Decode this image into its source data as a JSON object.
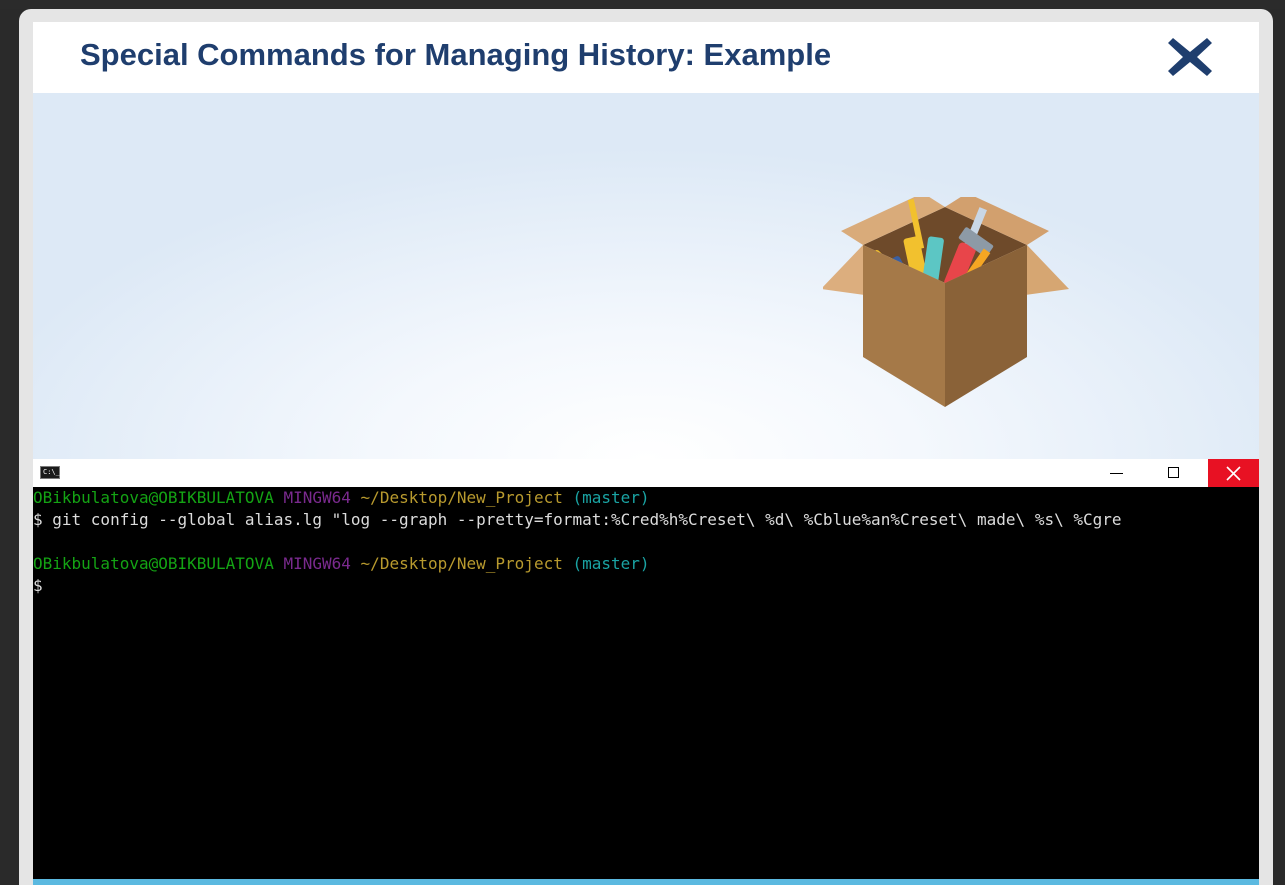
{
  "modal": {
    "title": "Special Commands for Managing History: Example"
  },
  "terminal": {
    "sys_icon_label": "C:\\_",
    "prompt1": {
      "user_host": "OBikbulatova@OBIKBULATOVA",
      "shell": "MINGW64",
      "path": "~/Desktop/New_Project",
      "branch": "(master)"
    },
    "command_line": "$ git config --global alias.lg \"log --graph --pretty=format:%Cred%h%Creset\\ %d\\ %Cblue%an%Creset\\ made\\ %s\\ %Cgre",
    "prompt2": {
      "user_host": "OBikbulatova@OBIKBULATOVA",
      "shell": "MINGW64",
      "path": "~/Desktop/New_Project",
      "branch": "(master)"
    },
    "cursor_line": "$"
  },
  "icons": {
    "close": "close-icon",
    "toolbox": "toolbox-illustration",
    "minimize": "minimize-icon",
    "maximize": "maximize-icon",
    "window_close": "window-close-icon"
  },
  "colors": {
    "title": "#1f3e6e",
    "close_x": "#1f3e6e",
    "window_close_bg": "#e81123",
    "prompt_user": "#14a314",
    "prompt_shell": "#7a2a8e",
    "prompt_path": "#b89a2e",
    "prompt_branch": "#1aa3a3",
    "bottom_bar": "#5bb9e0"
  }
}
